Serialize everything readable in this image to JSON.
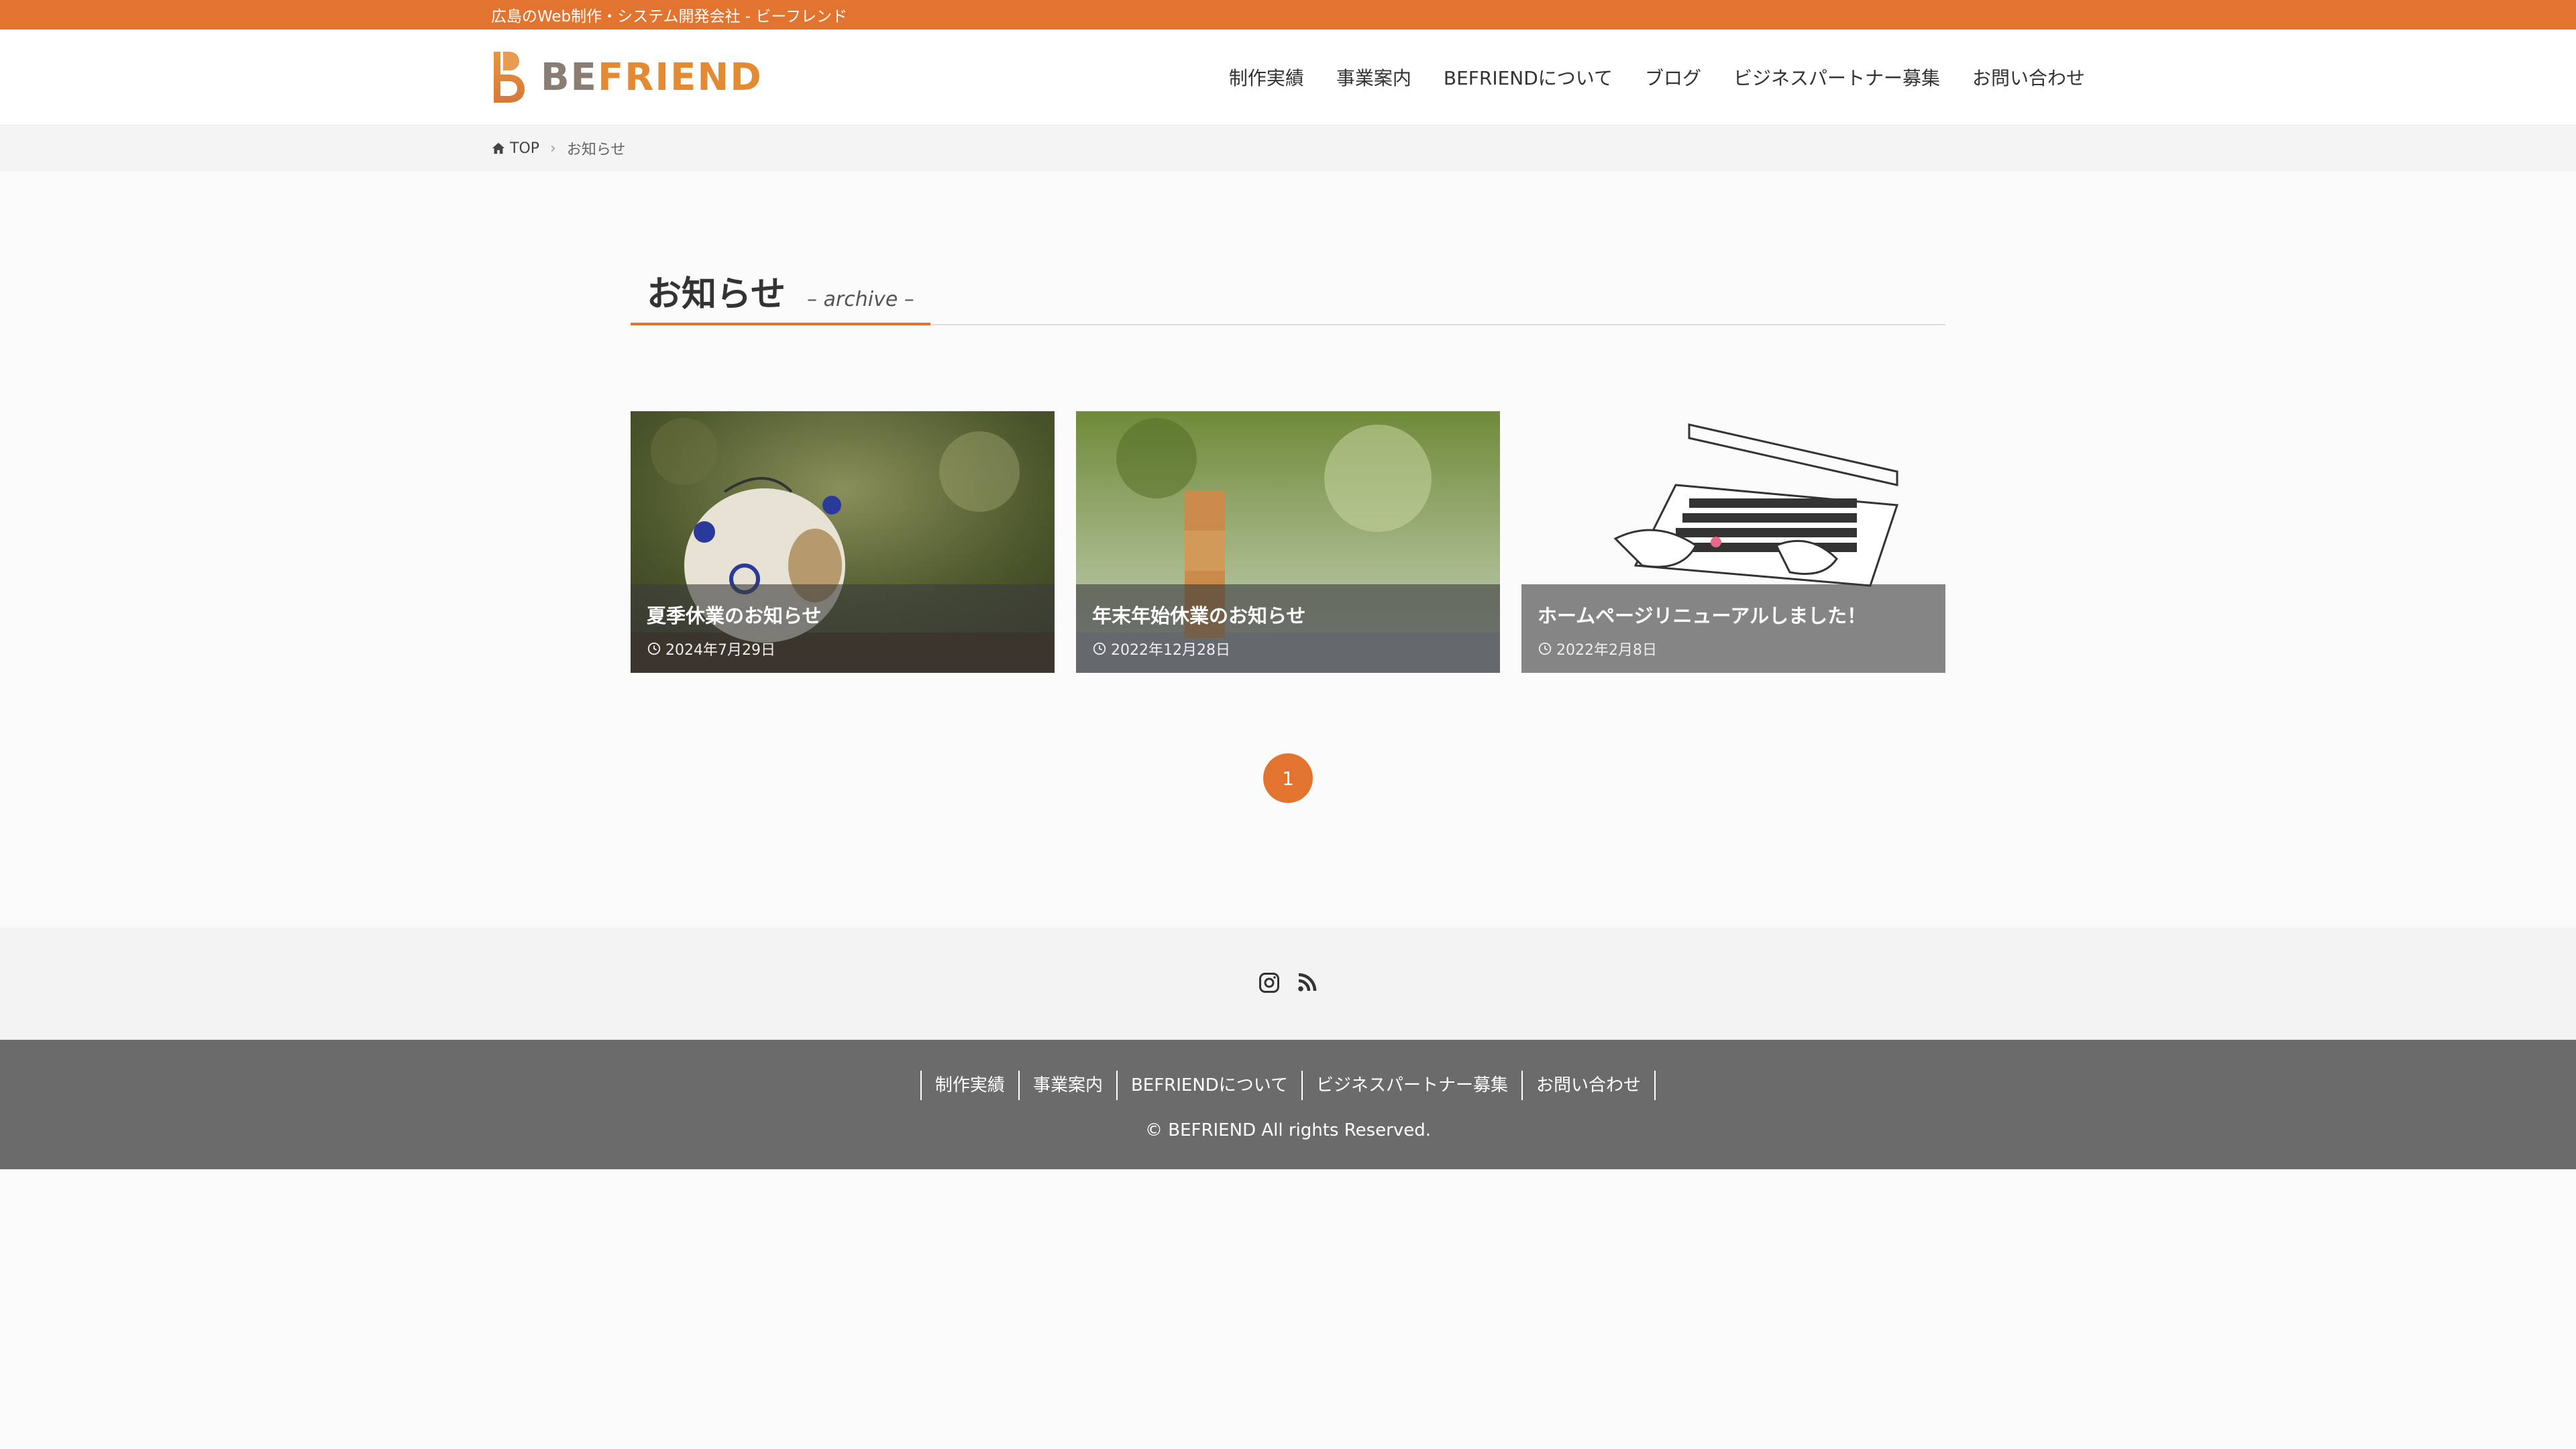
{
  "topbar": {
    "text": "広島のWeb制作・システム開発会社 - ビーフレンド"
  },
  "header": {
    "logo_prefix": "BE",
    "logo_suffix": "FRIEND",
    "nav": [
      {
        "label": "制作実績"
      },
      {
        "label": "事業案内"
      },
      {
        "label": "BEFRIENDについて"
      },
      {
        "label": "ブログ"
      },
      {
        "label": "ビジネスパートナー募集"
      },
      {
        "label": "お問い合わせ"
      }
    ]
  },
  "breadcrumb": {
    "home": "TOP",
    "current": "お知らせ"
  },
  "page": {
    "title": "お知らせ",
    "subtitle": "– archive –"
  },
  "posts": [
    {
      "title": "夏季休業のお知らせ",
      "date": "2024年7月29日"
    },
    {
      "title": "年末年始休業のお知らせ",
      "date": "2022年12月28日"
    },
    {
      "title": "ホームページリニューアルしました！",
      "date": "2022年2月8日"
    }
  ],
  "pagination": {
    "current": "1"
  },
  "footer": {
    "social": [
      "instagram-icon",
      "rss-icon"
    ],
    "nav": [
      {
        "label": "制作実績"
      },
      {
        "label": "事業案内"
      },
      {
        "label": "BEFRIENDについて"
      },
      {
        "label": "ビジネスパートナー募集"
      },
      {
        "label": "お問い合わせ"
      }
    ],
    "copyright": "© BEFRIEND All rights Reserved."
  },
  "colors": {
    "accent": "#e37430",
    "footer_bg": "#6b6b6b"
  }
}
